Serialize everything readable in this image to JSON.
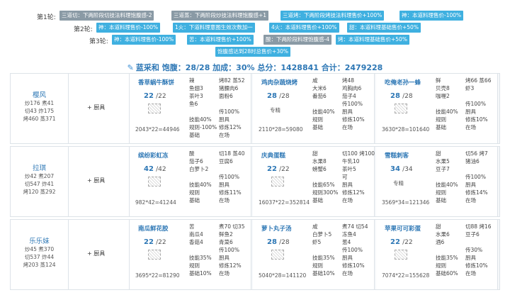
{
  "rounds": [
    {
      "label": "第1轮:",
      "tags": [
        {
          "text": "三道切：下两阶段切技法料理饱腹感-2",
          "color": "gray"
        },
        {
          "text": "三道蒸：下两阶段炒技法料理饱腹感+1",
          "color": "gray"
        },
        {
          "text": "三道烤：下两阶段烤技法料理售价+100%",
          "color": "blue"
        },
        {
          "text": "神：本道料理售价-100%",
          "color": "blue"
        }
      ]
    },
    {
      "label": "第2轮:",
      "tags": [
        {
          "text": "神：本道料理售价-100%",
          "color": "blue"
        },
        {
          "text": "1火：下道料理意图生效次数加一",
          "color": "blue"
        },
        {
          "text": "4火：本道料理售价+100%",
          "color": "blue"
        },
        {
          "text": "甜：本道料理基础售价+50%",
          "color": "blue"
        }
      ]
    },
    {
      "label": "第3轮:",
      "tags": [
        {
          "text": "神：本道料理售价-100%",
          "color": "blue"
        },
        {
          "text": "苦：本道料理售价+100%",
          "color": "blue"
        },
        {
          "text": "酸：下两阶段料理饱腹感-4",
          "color": "gray"
        },
        {
          "text": "烤：本道料理基础售价+50%",
          "color": "blue"
        }
      ]
    },
    {
      "label": "",
      "tags": [
        {
          "text": "饱腹感达到28时总售价+30%",
          "color": "blue"
        }
      ]
    }
  ],
  "summary": "蓝采和 饱腹：28/28 加成：30% 总分：1428841 合计：2479228",
  "equip_label": "+ 厨具",
  "chefs": [
    {
      "name": "樱风",
      "stats": [
        "炒176 煮41",
        "切43 炸175",
        "烤460 蒸371"
      ],
      "dishes": [
        {
          "name": "香草蜗牛酥饼",
          "qty": "22",
          "max": "/22",
          "tag": "",
          "total": "2043*22=44946",
          "lines": [
            [
              "辣",
              "烤82 蒸52"
            ],
            [
              "鱼翅3",
              "猪腰肉6"
            ],
            [
              "茶叶3",
              "面粉6"
            ],
            [
              "鱼6",
              ""
            ],
            [
              "",
              "传100%"
            ],
            [
              "技能40%",
              "厨具"
            ],
            [
              "规则-100%",
              "修炼12%"
            ],
            [
              "基础",
              "在场"
            ]
          ]
        },
        {
          "name": "鸡肉杂蔬烧烤",
          "qty": "28",
          "max": "/28",
          "tag": "专精",
          "total": "2110*28=59080",
          "lines": [
            [
              "咸",
              "烤48"
            ],
            [
              "大米6",
              "鸡胸肉6"
            ],
            [
              "番茄6",
              "茄子4"
            ],
            [
              "",
              ""
            ],
            [
              "",
              "传100%"
            ],
            [
              "技能40%",
              "厨具"
            ],
            [
              "规则",
              "修炼10%"
            ],
            [
              "基础",
              "在场"
            ]
          ]
        },
        {
          "name": "吃俺老孙一蜂",
          "qty": "28",
          "max": "/28",
          "tag": "",
          "total": "3630*28=101640",
          "lines": [
            [
              "鲜",
              "烤66 蒸66"
            ],
            [
              "贝壳8",
              "虾3"
            ],
            [
              "咖喱2",
              ""
            ],
            [
              "",
              ""
            ],
            [
              "",
              "传100%"
            ],
            [
              "技能40%",
              "厨具"
            ],
            [
              "规则",
              "修炼10%"
            ],
            [
              "基础",
              "在场"
            ]
          ]
        }
      ]
    },
    {
      "name": "拉琪",
      "stats": [
        "炒42 煮207",
        "切547 炸41",
        "烤120 蒸292"
      ],
      "dishes": [
        {
          "name": "缤纷彩虹冻",
          "qty": "42",
          "max": "/42",
          "tag": "",
          "total": "982*42=41244",
          "lines": [
            [
              "酸",
              "切18 蒸40"
            ],
            [
              "茄子6",
              "豆腐6"
            ],
            [
              "白萝卜2",
              ""
            ],
            [
              "",
              ""
            ],
            [
              "",
              "传100%"
            ],
            [
              "技能40%",
              "厨具"
            ],
            [
              "规则",
              "修炼11%"
            ],
            [
              "基础",
              "在场"
            ]
          ]
        },
        {
          "name": "庆典蛋糕",
          "qty": "22",
          "max": "/22",
          "tag": "",
          "total": "16037*22=352814",
          "lines": [
            [
              "甜",
              "切100 烤100"
            ],
            [
              "水果8",
              "牛乳10"
            ],
            [
              "螃蟹6",
              "茶叶5"
            ],
            [
              "",
              "可"
            ],
            [
              "技能65%",
              "厨具"
            ],
            [
              "规则300%",
              "修炼12%"
            ],
            [
              "基础",
              "在场"
            ],
            [
              "",
              ""
            ]
          ]
        },
        {
          "name": "雪糕刺客",
          "qty": "34",
          "max": "/34",
          "tag": "专精",
          "total": "3569*34=121346",
          "lines": [
            [
              "甜",
              "切56 烤7"
            ],
            [
              "水果5",
              "猪油6"
            ],
            [
              "豆子7",
              ""
            ],
            [
              "",
              ""
            ],
            [
              "",
              "传100%"
            ],
            [
              "技能40%",
              "厨具"
            ],
            [
              "规则",
              "修炼14%"
            ],
            [
              "基础",
              "在场"
            ]
          ]
        }
      ]
    },
    {
      "name": "乐乐妹",
      "stats": [
        "炒45 煮370",
        "切537 炸44",
        "烤203 蒸124"
      ],
      "dishes": [
        {
          "name": "南瓜鲜花胶",
          "qty": "22",
          "max": "/22",
          "tag": "",
          "total": "3695*22=81290",
          "lines": [
            [
              "苦",
              "煮70 切35"
            ],
            [
              "南瓜4",
              "鲜鱼2"
            ],
            [
              "香菇4",
              "青菜6"
            ],
            [
              "",
              ""
            ],
            [
              "",
              "传100%"
            ],
            [
              "技能35%",
              "厨具"
            ],
            [
              "规则",
              "修炼12%"
            ],
            [
              "基础10%",
              "在场"
            ]
          ]
        },
        {
          "name": "萝卜丸子汤",
          "qty": "28",
          "max": "/28",
          "tag": "",
          "total": "5040*28=141120",
          "lines": [
            [
              "咸",
              "煮74 切54"
            ],
            [
              "白萝卜5",
              "冻鱼4"
            ],
            [
              "虾5",
              "葱4"
            ],
            [
              "",
              ""
            ],
            [
              "",
              "传100%"
            ],
            [
              "技能35%",
              "厨具"
            ],
            [
              "规则",
              "修炼10%"
            ],
            [
              "基础10%",
              "在场"
            ]
          ]
        },
        {
          "name": "苹果可可彩蛋",
          "qty": "22",
          "max": "/22",
          "tag": "",
          "total": "7074*22=155628",
          "lines": [
            [
              "甜",
              "切88 烤16"
            ],
            [
              "水果6",
              "豆子6"
            ],
            [
              "酒6",
              ""
            ],
            [
              "",
              "传30%"
            ],
            [
              "技能35%",
              "厨具"
            ],
            [
              "规则",
              "修炼10%"
            ],
            [
              "基础60%",
              "在场"
            ],
            [
              "",
              ""
            ]
          ]
        }
      ]
    }
  ]
}
